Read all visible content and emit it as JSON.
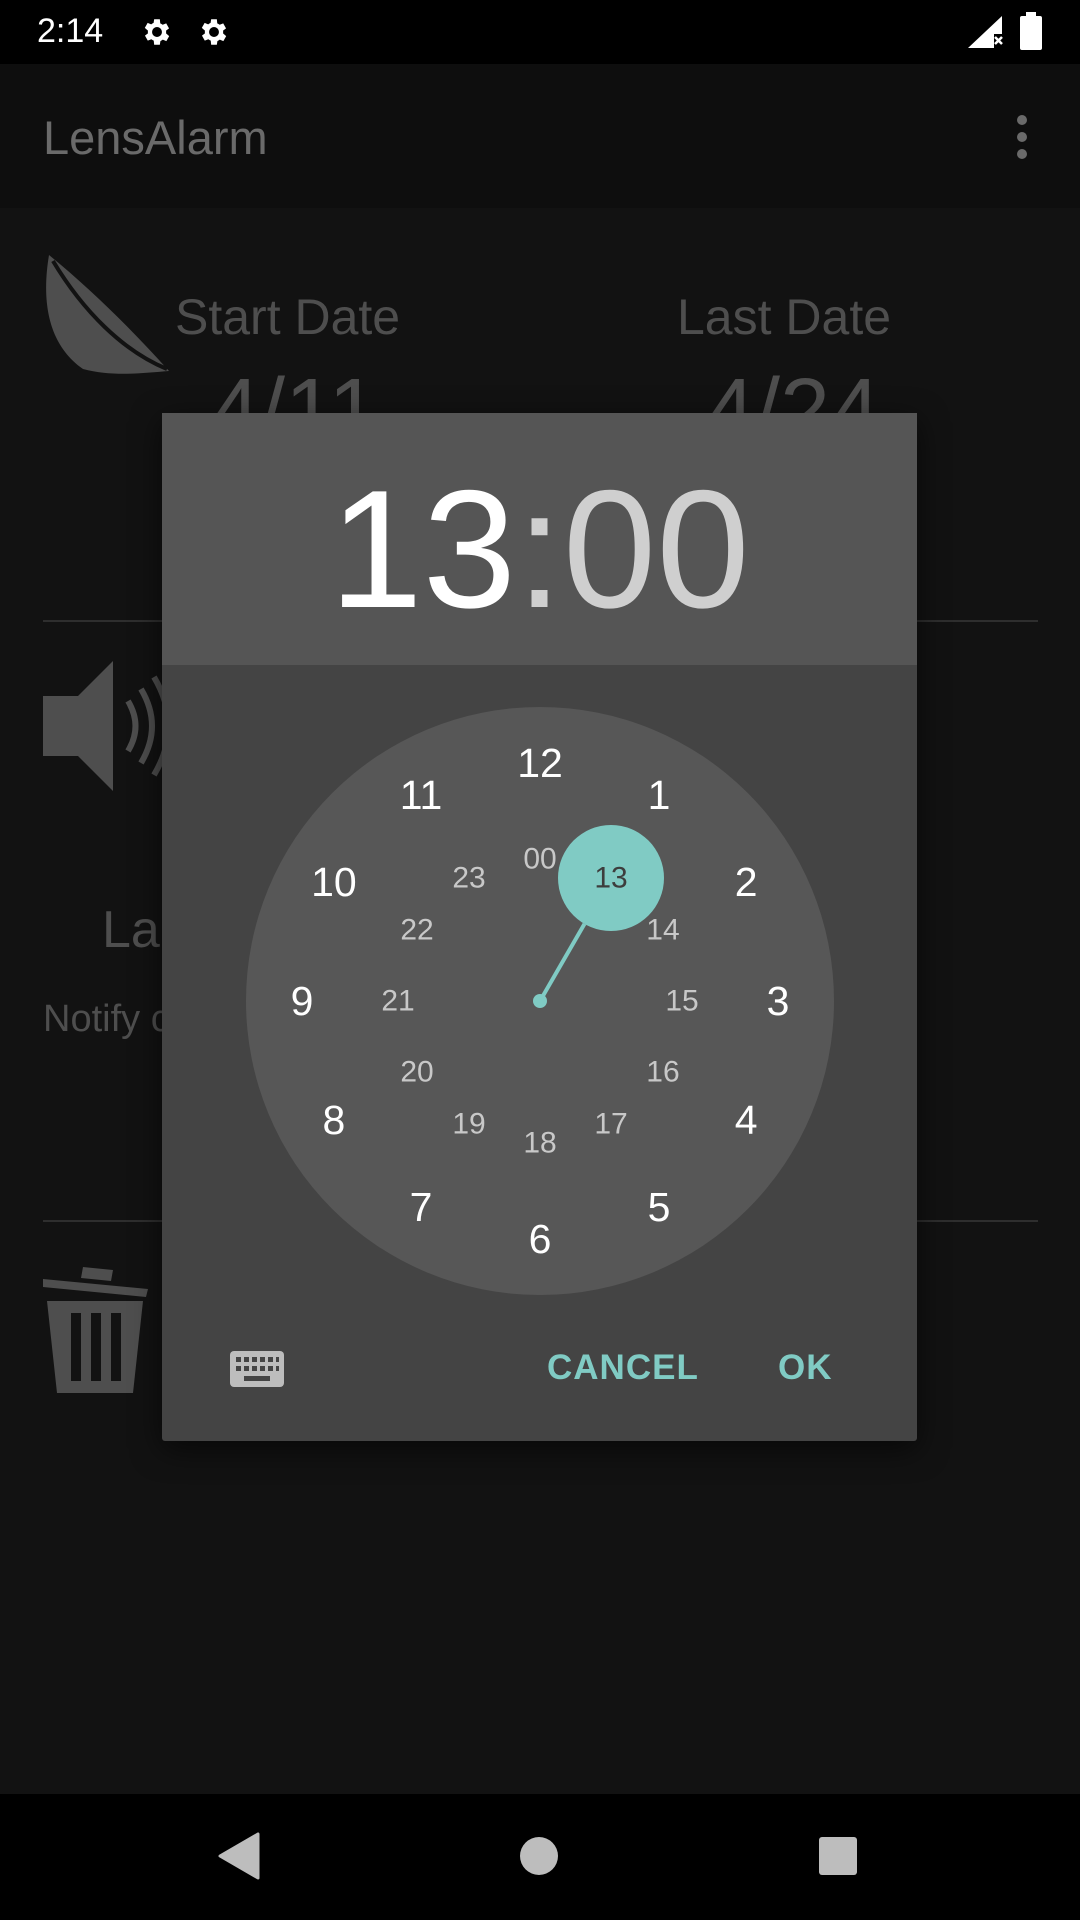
{
  "status_bar": {
    "time": "2:14",
    "icons": [
      "gear-icon",
      "gear-icon",
      "signal-no-data-icon",
      "battery-full-icon"
    ]
  },
  "app_bar": {
    "title": "LensAlarm",
    "menu_icon": "more-vert-icon"
  },
  "background": {
    "start_label": "Start Date",
    "start_value": "4/11",
    "last_label": "Last Date",
    "last_value": "4/24",
    "sound_label_partial": "La",
    "notify_partial": "Notify c",
    "icons": [
      "contact-lens-icon",
      "speaker-icon",
      "trash-icon"
    ]
  },
  "time_picker": {
    "hour": "13",
    "separator": ":",
    "minute": "00",
    "selected_hour": "13",
    "outer_hours": [
      "12",
      "1",
      "2",
      "3",
      "4",
      "5",
      "6",
      "7",
      "8",
      "9",
      "10",
      "11"
    ],
    "inner_hours": [
      "00",
      "13",
      "14",
      "15",
      "16",
      "17",
      "18",
      "19",
      "20",
      "21",
      "22",
      "23"
    ],
    "cancel_label": "CANCEL",
    "ok_label": "OK",
    "keyboard_icon": "keyboard-icon"
  },
  "colors": {
    "accent": "#80cbc4",
    "dialog_header": "#555555",
    "dialog_body": "#444444",
    "clock_face": "#575757"
  },
  "nav_bar": {
    "icons": [
      "back-icon",
      "home-icon",
      "recents-icon"
    ]
  }
}
